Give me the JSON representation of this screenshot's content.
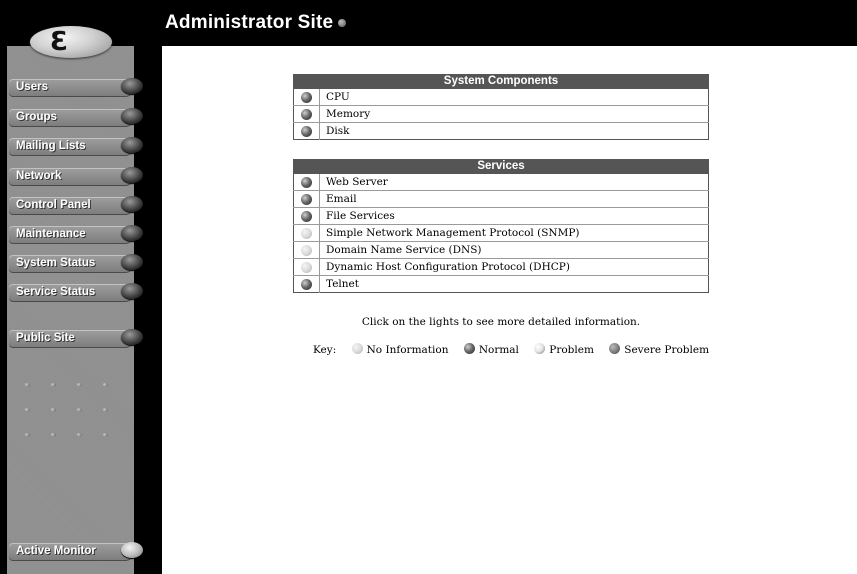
{
  "header": {
    "title": "Administrator Site"
  },
  "sidebar": {
    "items": [
      {
        "label": "Users",
        "light": "off"
      },
      {
        "label": "Groups",
        "light": "off"
      },
      {
        "label": "Mailing Lists",
        "light": "off"
      },
      {
        "label": "Network",
        "light": "off"
      },
      {
        "label": "Control Panel",
        "light": "off"
      },
      {
        "label": "Maintenance",
        "light": "off"
      },
      {
        "label": "System Status",
        "light": "off"
      },
      {
        "label": "Service Status",
        "light": "off"
      },
      {
        "label": "Public Site",
        "light": "off"
      },
      {
        "label": "Active Monitor",
        "light": "on"
      }
    ]
  },
  "system_components": {
    "header": "System Components",
    "rows": [
      {
        "label": "CPU",
        "status": "normal"
      },
      {
        "label": "Memory",
        "status": "normal"
      },
      {
        "label": "Disk",
        "status": "normal"
      }
    ]
  },
  "services": {
    "header": "Services",
    "rows": [
      {
        "label": "Web Server",
        "status": "normal"
      },
      {
        "label": "Email",
        "status": "normal"
      },
      {
        "label": "File Services",
        "status": "normal"
      },
      {
        "label": "Simple Network Management Protocol (SNMP)",
        "status": "no-information"
      },
      {
        "label": "Domain Name Service (DNS)",
        "status": "no-information"
      },
      {
        "label": "Dynamic Host Configuration Protocol (DHCP)",
        "status": "no-information"
      },
      {
        "label": "Telnet",
        "status": "normal"
      }
    ]
  },
  "hint": "Click on the lights to see more detailed information.",
  "key": {
    "label": "Key:",
    "items": [
      {
        "label": "No Information",
        "status": "no-information"
      },
      {
        "label": "Normal",
        "status": "normal"
      },
      {
        "label": "Problem",
        "status": "problem"
      },
      {
        "label": "Severe Problem",
        "status": "severe-problem"
      }
    ]
  },
  "colors": {
    "header_bg": "#000000",
    "sidebar_panel": "#8f8f8f",
    "table_header_bg": "#555555"
  }
}
